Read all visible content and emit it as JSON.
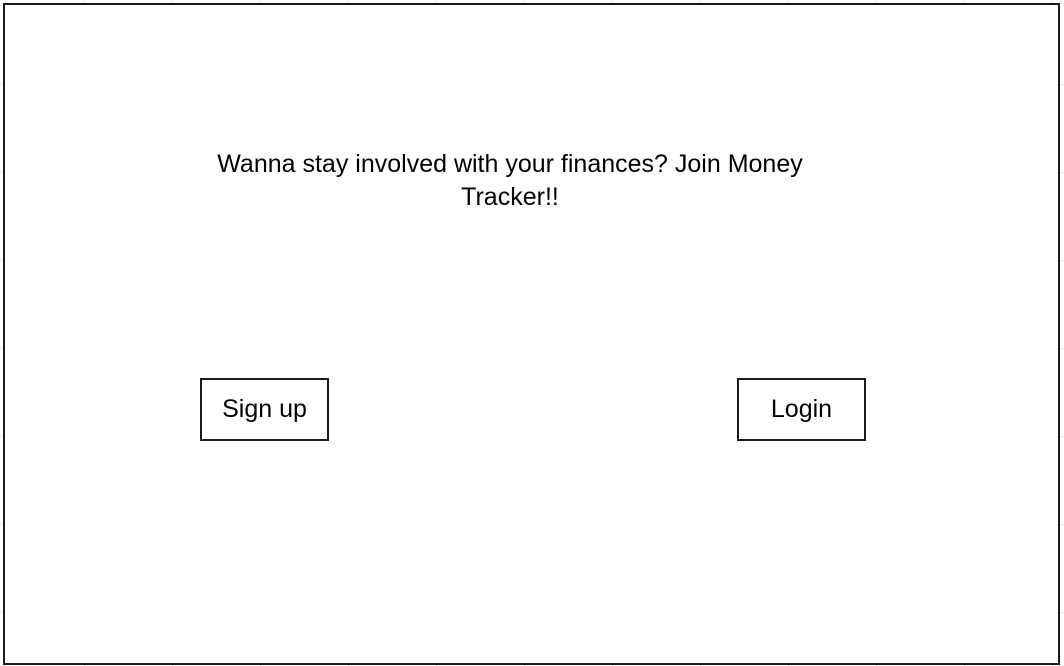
{
  "main": {
    "headline": "Wanna stay involved with your finances? Join Money Tracker!!",
    "buttons": {
      "signup_label": "Sign up",
      "login_label": "Login"
    }
  },
  "colors": {
    "background": "#ffffff",
    "border": "#1a1a1a",
    "text": "#000000",
    "grid": "#e6e6e6"
  }
}
